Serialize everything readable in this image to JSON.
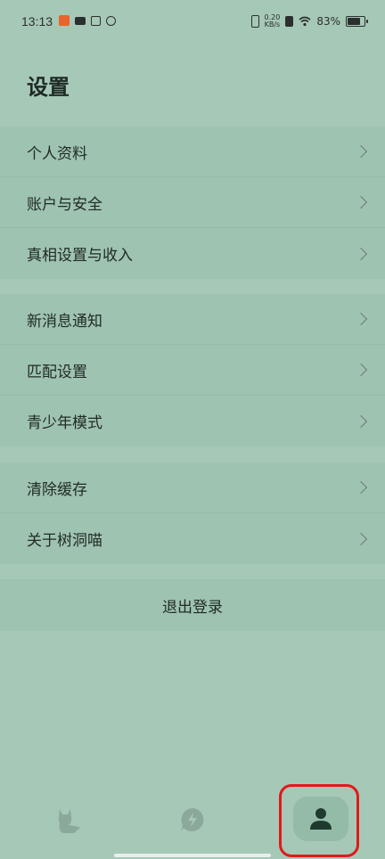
{
  "status_bar": {
    "time": "13:13",
    "speed_value": "0.20",
    "speed_unit": "KB/s",
    "battery": "83%"
  },
  "page": {
    "title": "设置"
  },
  "sections": [
    {
      "items": [
        {
          "label": "个人资料"
        },
        {
          "label": "账户与安全"
        },
        {
          "label": "真相设置与收入"
        }
      ]
    },
    {
      "items": [
        {
          "label": "新消息通知"
        },
        {
          "label": "匹配设置"
        },
        {
          "label": "青少年模式"
        }
      ]
    },
    {
      "items": [
        {
          "label": "清除缓存"
        },
        {
          "label": "关于树洞喵"
        }
      ]
    }
  ],
  "logout_label": "退出登录",
  "tabbar": {
    "tabs": [
      {
        "icon": "cat-icon"
      },
      {
        "icon": "lightning-chat-icon"
      },
      {
        "icon": "person-icon",
        "active": true
      }
    ]
  },
  "colors": {
    "background": "#a6c8b7",
    "row_background": "#9fc3b1",
    "highlight": "#e01a1a"
  }
}
